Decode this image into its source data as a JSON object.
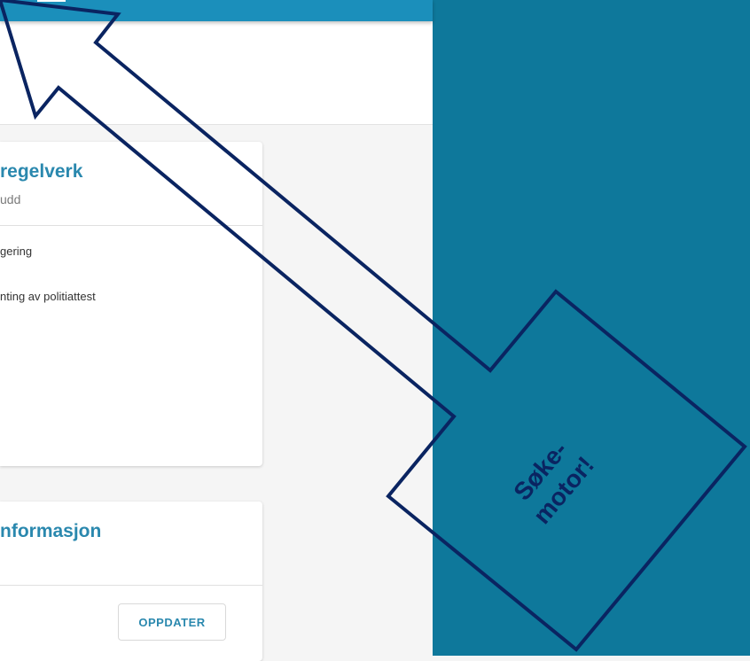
{
  "rules_card": {
    "title": "regelverk",
    "subtitle": "udd",
    "items": [
      "gering",
      "nting av politiattest"
    ]
  },
  "info_card": {
    "title": "nformasjon",
    "update_button_label": "OPPDATER"
  },
  "annotation": {
    "line1": "Søke-",
    "line2": "motor!"
  },
  "colors": {
    "topbar": "#1b8fbb",
    "side_panel": "#0e789b",
    "accent_text": "#2a88ae",
    "arrow_stroke": "#0a2461"
  }
}
